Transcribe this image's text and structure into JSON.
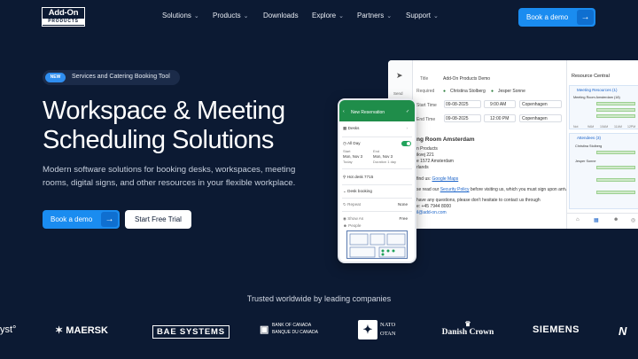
{
  "brand": {
    "logo_top": "Add-On",
    "logo_bottom": "PRODUCTS"
  },
  "nav": {
    "items": [
      {
        "label": "Solutions",
        "has_dropdown": true
      },
      {
        "label": "Products",
        "has_dropdown": true
      },
      {
        "label": "Downloads",
        "has_dropdown": false
      },
      {
        "label": "Explore",
        "has_dropdown": true
      },
      {
        "label": "Partners",
        "has_dropdown": true
      },
      {
        "label": "Support",
        "has_dropdown": true
      }
    ],
    "cta_label": "Book a demo",
    "chevron_icon": "chevron-down-icon",
    "arrow_icon": "arrow-right-icon"
  },
  "hero": {
    "badge_new": "NEW",
    "badge_text": "Services and Catering Booking Tool",
    "title_line1": "Workspace & Meeting",
    "title_line2": "Scheduling Solutions",
    "subtitle": "Modern software solutions for booking desks, workspaces, meeting rooms, digital signs, and other resources in your flexible workplace.",
    "primary_cta": "Book a demo",
    "secondary_cta": "Start Free Trial"
  },
  "desktop_mock": {
    "side_label": "Send",
    "title_label": "Title",
    "title_value": "Add-On Products Demo",
    "required_label": "Required",
    "attendee1": "Christina Stolberg",
    "attendee2": "Jesper Sonne",
    "start_label": "Start Time",
    "start_date": "09-08-2025",
    "start_time": "9:00 AM",
    "end_label": "End Time",
    "end_date": "09-08-2025",
    "end_time": "12:00 PM",
    "tz": "Copenhagen",
    "room_name": "ng Room Amsterdam",
    "body_lines": [
      "n Products",
      "ikvej 221",
      "e 1572 Amsterdam",
      "rlands"
    ],
    "find_us_prefix": "find us: ",
    "find_us_link": "Google Maps",
    "policy_prefix": "se read our ",
    "policy_link": "Security Policy",
    "policy_suffix": " before visiting us, which you must sign upon arrival.",
    "questions": "have any questions, please don't hesitate to contact us through",
    "phone": "e: +45 7944 8000",
    "email": "il@add-on.com",
    "resource_central": "Resource Central",
    "meeting_resources": "Meeting Resources (1)",
    "meeting_room": "Meeting Room Amsterdam (18)",
    "attendees": "Attendees (3)",
    "people": [
      "Christina Stolberg",
      "Jesper Sonne"
    ],
    "ticks": [
      "Not",
      "9AM",
      "10AM",
      "11AM",
      "12PM"
    ]
  },
  "phone_mock": {
    "title": "New Reservation",
    "desks": "Desks",
    "all_day": "All Day",
    "start_label": "Start",
    "start_date": "Mon, Nov 3",
    "start_sub": "Today",
    "end_label": "End",
    "end_date": "Mon, Nov 3",
    "end_sub": "Duration 1 day",
    "hot_desk": "Hot desk 7715",
    "desk_booking": "Desk booking",
    "repeat_label": "Repeat",
    "repeat_value": "None",
    "show_as_label": "Show As",
    "show_as_value": "Free",
    "people_label": "People"
  },
  "trusted": {
    "heading": "Trusted worldwide by leading companies",
    "logos": [
      "yst°",
      "MAERSK",
      "BAE SYSTEMS",
      "BANK OF CANADA",
      "BANQUE DU CANADA",
      "NATO",
      "OTAN",
      "Danish Crown",
      "SIEMENS",
      "N"
    ]
  },
  "colors": {
    "background": "#0c1a33",
    "accent": "#1a8cf0",
    "phone_header": "#1f8d4a"
  }
}
